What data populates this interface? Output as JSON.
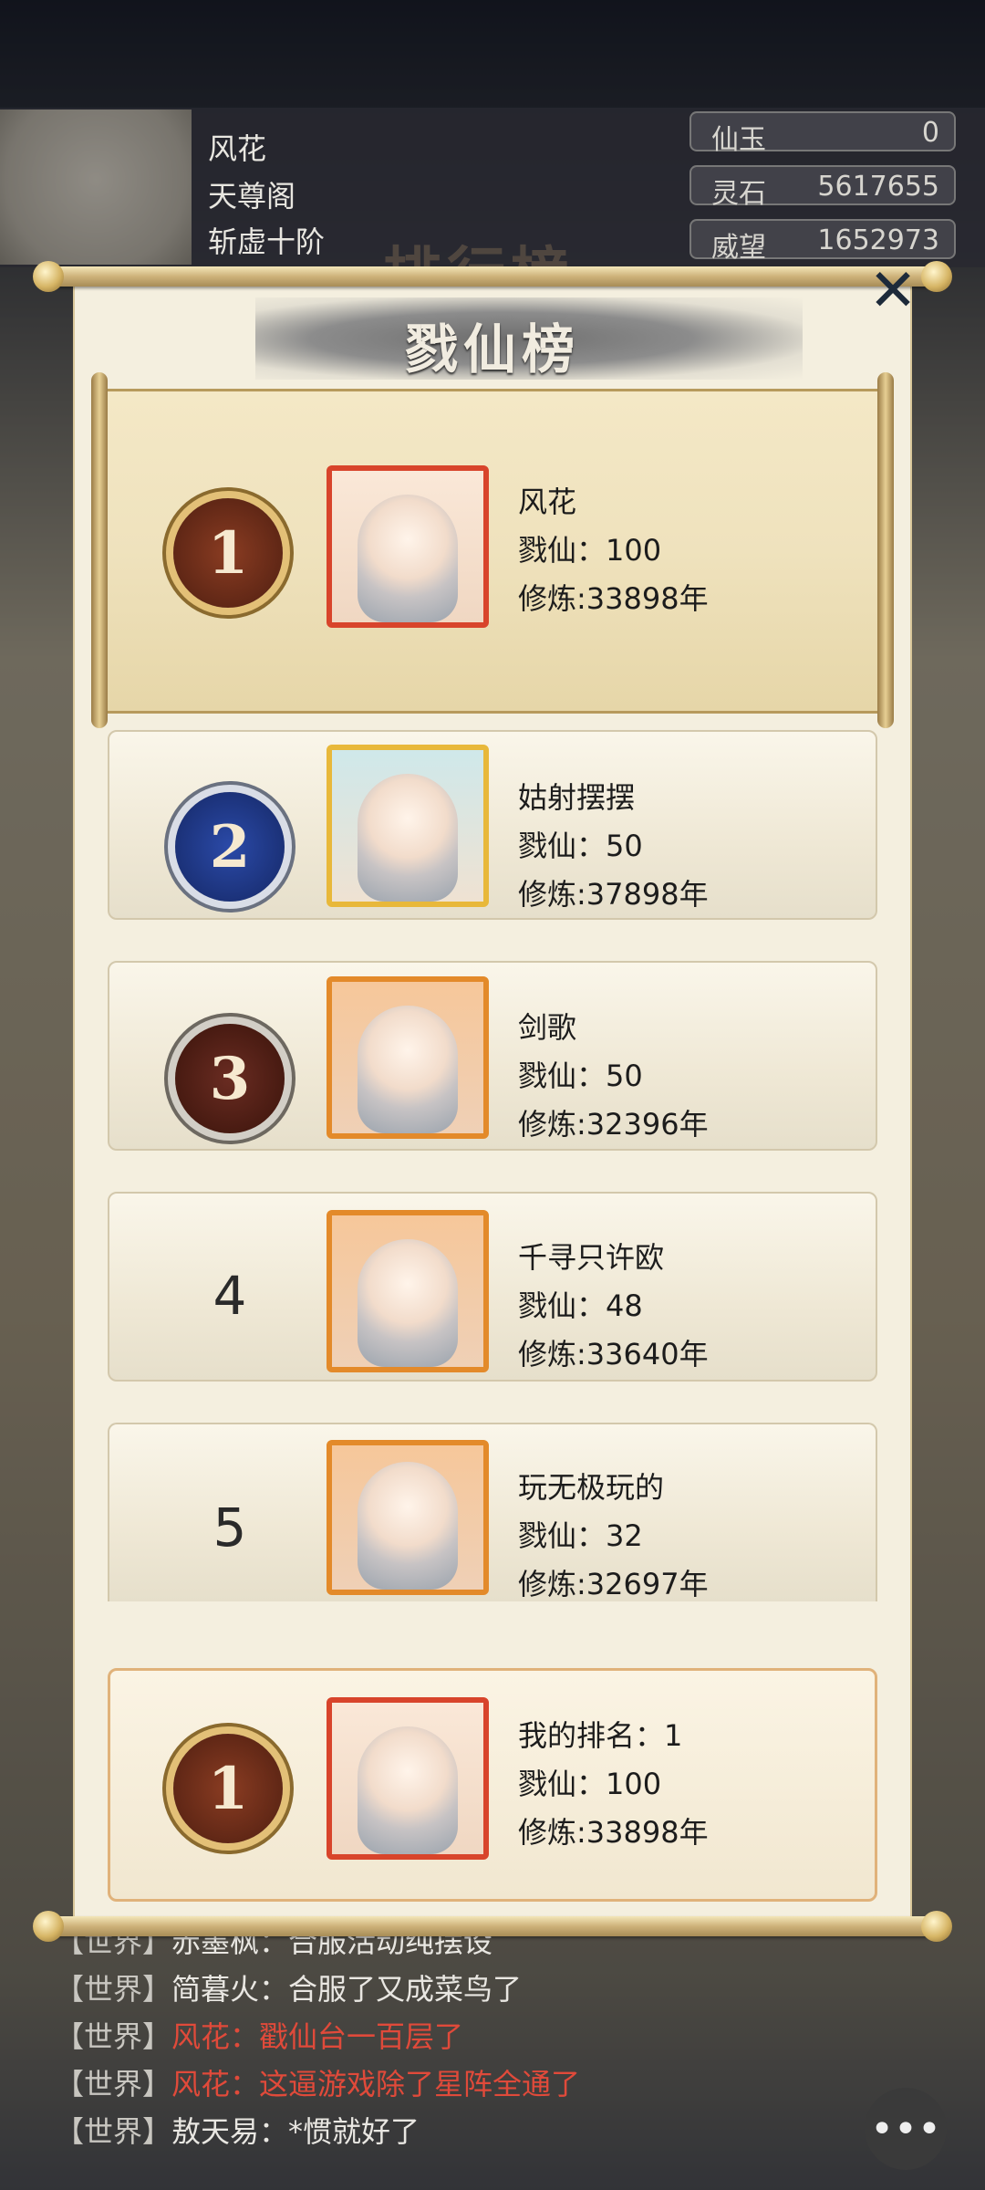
{
  "player": {
    "name": "风花",
    "sect": "天尊阁",
    "realm": "斩虚十阶"
  },
  "resources": [
    {
      "label": "仙玉",
      "value": "0"
    },
    {
      "label": "灵石",
      "value": "5617655"
    },
    {
      "label": "威望",
      "value": "1652973"
    }
  ],
  "background": {
    "title": "排行榜"
  },
  "modal": {
    "title": "戮仙榜",
    "close_icon": "close-x-icon",
    "entries": [
      {
        "rank": "1",
        "name": "风花",
        "stat1": "戮仙：100",
        "stat2": "修炼:33898年"
      },
      {
        "rank": "2",
        "name": "姑射摆摆",
        "stat1": "戮仙：50",
        "stat2": "修炼:37898年"
      },
      {
        "rank": "3",
        "name": "剑歌",
        "stat1": "戮仙：50",
        "stat2": "修炼:32396年"
      },
      {
        "rank": "4",
        "name": "千寻只许欧",
        "stat1": "戮仙：48",
        "stat2": "修炼:33640年"
      },
      {
        "rank": "5",
        "name": "玩无极玩的",
        "stat1": "戮仙：32",
        "stat2": "修炼:32697年"
      }
    ],
    "mine": {
      "rank": "1",
      "label": "我的排名：1",
      "stat1": "戮仙：100",
      "stat2": "修炼:33898年"
    }
  },
  "chat": [
    {
      "tag": "【世界】",
      "speaker": "赤墨枫：",
      "text": "合服活动纯摆设",
      "red": false
    },
    {
      "tag": "【世界】",
      "speaker": "简暮火：",
      "text": "合服了又成菜鸟了",
      "red": false
    },
    {
      "tag": "【世界】",
      "speaker": "风花：",
      "text": "戳仙台一百层了",
      "red": true
    },
    {
      "tag": "【世界】",
      "speaker": "风花：",
      "text": "这逼游戏除了星阵全通了",
      "red": true
    },
    {
      "tag": "【世界】",
      "speaker": "敖天易：",
      "text": "*惯就好了",
      "red": false
    }
  ],
  "chat_button_icon": "chat-bubble-icon"
}
